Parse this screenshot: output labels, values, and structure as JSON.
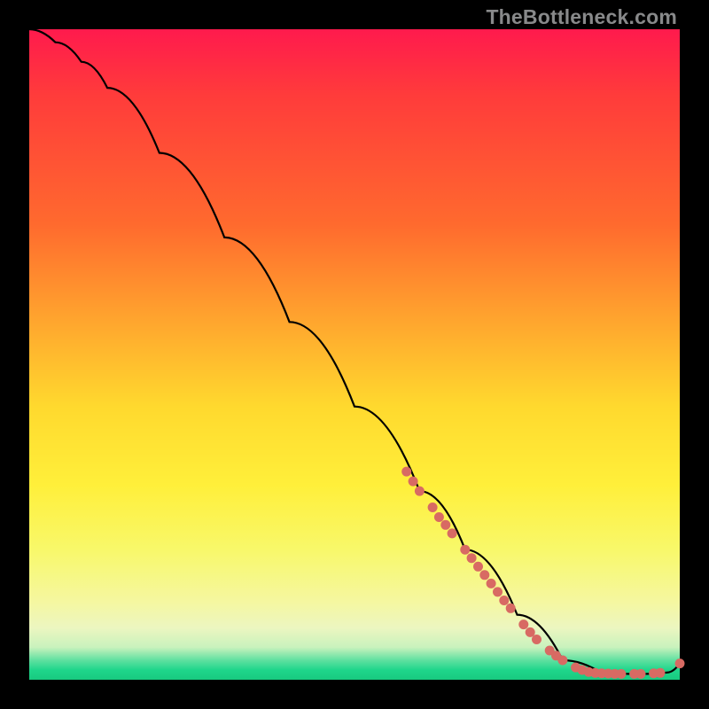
{
  "watermark": "TheBottleneck.com",
  "chart_data": {
    "type": "line",
    "title": "",
    "xlabel": "",
    "ylabel": "",
    "xlim": [
      0,
      100
    ],
    "ylim": [
      0,
      100
    ],
    "grid": false,
    "legend": false,
    "series": [
      {
        "name": "curve",
        "x": [
          0,
          4,
          8,
          12,
          20,
          30,
          40,
          50,
          60,
          67,
          75,
          82,
          88,
          92,
          95,
          98,
          100
        ],
        "values": [
          100,
          98,
          95,
          91,
          81,
          68,
          55,
          42,
          29,
          20,
          10,
          3,
          1,
          0.9,
          0.9,
          1.1,
          2.5
        ],
        "color": "#000000"
      }
    ],
    "markers": [
      {
        "name": "dots",
        "color": "#d86a63",
        "radius": 5.5,
        "points": [
          {
            "x": 58,
            "y": 32
          },
          {
            "x": 59,
            "y": 30.5
          },
          {
            "x": 60,
            "y": 29
          },
          {
            "x": 62,
            "y": 26.5
          },
          {
            "x": 63,
            "y": 25
          },
          {
            "x": 64,
            "y": 23.8
          },
          {
            "x": 65,
            "y": 22.5
          },
          {
            "x": 67,
            "y": 20
          },
          {
            "x": 68,
            "y": 18.7
          },
          {
            "x": 69,
            "y": 17.4
          },
          {
            "x": 70,
            "y": 16.1
          },
          {
            "x": 71,
            "y": 14.8
          },
          {
            "x": 72,
            "y": 13.5
          },
          {
            "x": 73,
            "y": 12.2
          },
          {
            "x": 74,
            "y": 11
          },
          {
            "x": 76,
            "y": 8.5
          },
          {
            "x": 77,
            "y": 7.3
          },
          {
            "x": 78,
            "y": 6.2
          },
          {
            "x": 80,
            "y": 4.5
          },
          {
            "x": 81,
            "y": 3.7
          },
          {
            "x": 82,
            "y": 3
          },
          {
            "x": 84,
            "y": 1.9
          },
          {
            "x": 85,
            "y": 1.5
          },
          {
            "x": 86,
            "y": 1.2
          },
          {
            "x": 87,
            "y": 1.05
          },
          {
            "x": 88,
            "y": 1
          },
          {
            "x": 89,
            "y": 0.95
          },
          {
            "x": 90,
            "y": 0.9
          },
          {
            "x": 91,
            "y": 0.9
          },
          {
            "x": 93,
            "y": 0.9
          },
          {
            "x": 94,
            "y": 0.9
          },
          {
            "x": 96,
            "y": 1.0
          },
          {
            "x": 97,
            "y": 1.05
          },
          {
            "x": 100,
            "y": 2.5
          }
        ]
      }
    ]
  }
}
